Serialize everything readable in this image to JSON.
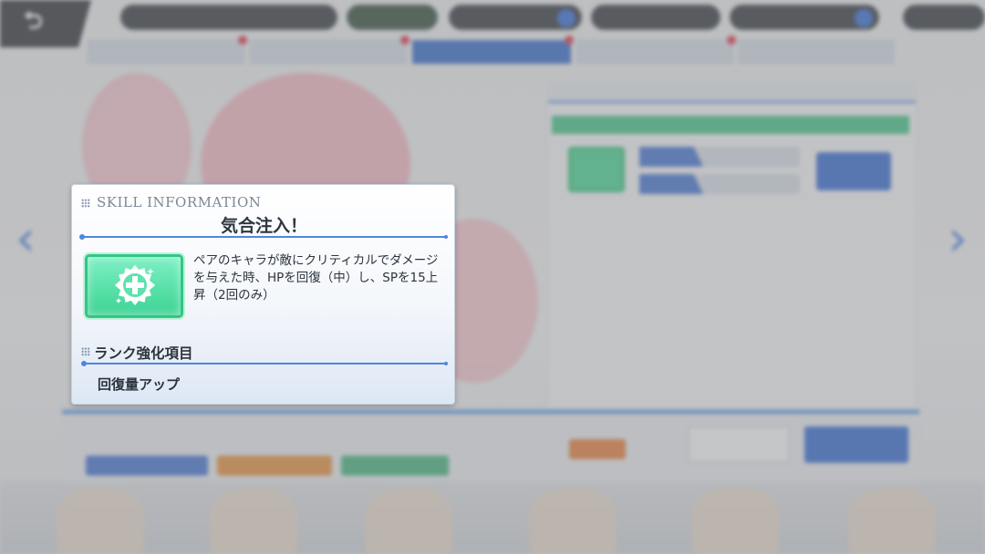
{
  "modal": {
    "header_en": "SKILL INFORMATION",
    "skill_name": "気合注入！",
    "skill_icon": "green-plus-badge-icon",
    "description": "ペアのキャラが敵にクリティカルでダメージを与えた時、HPを回復（中）し、SPを15上昇（2回のみ）",
    "rank_section_title": "ランク強化項目",
    "rank_items": [
      "回復量アップ"
    ]
  },
  "colors": {
    "accent_blue": "#4f86de",
    "skill_green": "#3ed396",
    "overlay": "rgba(140,140,140,0.45)"
  },
  "background_icons": {
    "back": "back-arrow-icon",
    "prev": "chevron-left-icon",
    "next": "chevron-right-icon"
  }
}
